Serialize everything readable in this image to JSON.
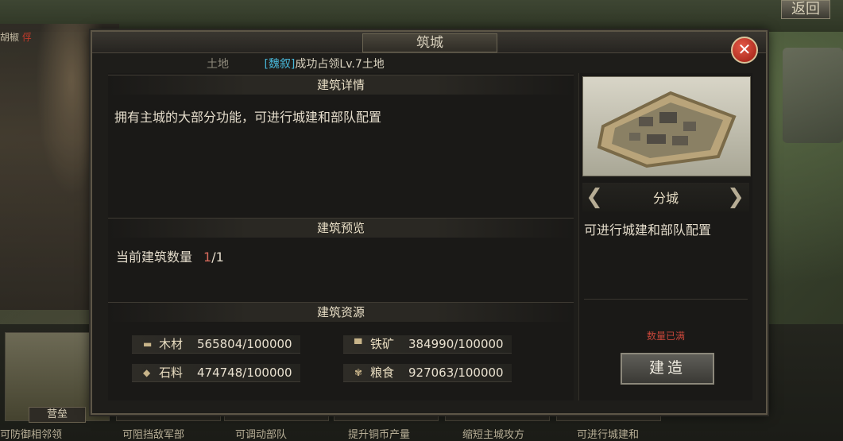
{
  "background": {
    "return_label": "返回",
    "left_tab_partial": "胡椒",
    "left_tab_red": "俘",
    "bottom_cards": [
      {
        "name": "营垒",
        "caption": "可防御相邻领"
      },
      {
        "name": "",
        "caption": "可阻挡敌军部"
      },
      {
        "name": "",
        "caption": "可调动部队"
      },
      {
        "name": "",
        "caption": "提升铜币产量"
      },
      {
        "name": "",
        "caption": "缩短主城攻方"
      },
      {
        "name": "",
        "caption": "可进行城建和"
      }
    ]
  },
  "dialog": {
    "title": "筑城",
    "close_label": "✕",
    "notice_faded": "土地",
    "notice_tag": "[魏叙]",
    "notice_text": "成功占领Lv.7土地",
    "details": {
      "header": "建筑详情",
      "description": "拥有主城的大部分功能，可进行城建和部队配置"
    },
    "preview": {
      "header": "建筑预览",
      "count_label": "当前建筑数量",
      "count_current": "1",
      "count_total": "/1"
    },
    "resources": {
      "header": "建筑资源",
      "items": [
        {
          "icon": "wood-icon",
          "label": "木材",
          "value": "565804/100000"
        },
        {
          "icon": "iron-icon",
          "label": "铁矿",
          "value": "384990/100000"
        },
        {
          "icon": "stone-icon",
          "label": "石料",
          "value": "474748/100000"
        },
        {
          "icon": "grain-icon",
          "label": "粮食",
          "value": "927063/100000"
        }
      ]
    },
    "side": {
      "building_name": "分城",
      "building_desc": "可进行城建和部队配置",
      "status": "数量已满",
      "build_label": "建造"
    }
  }
}
